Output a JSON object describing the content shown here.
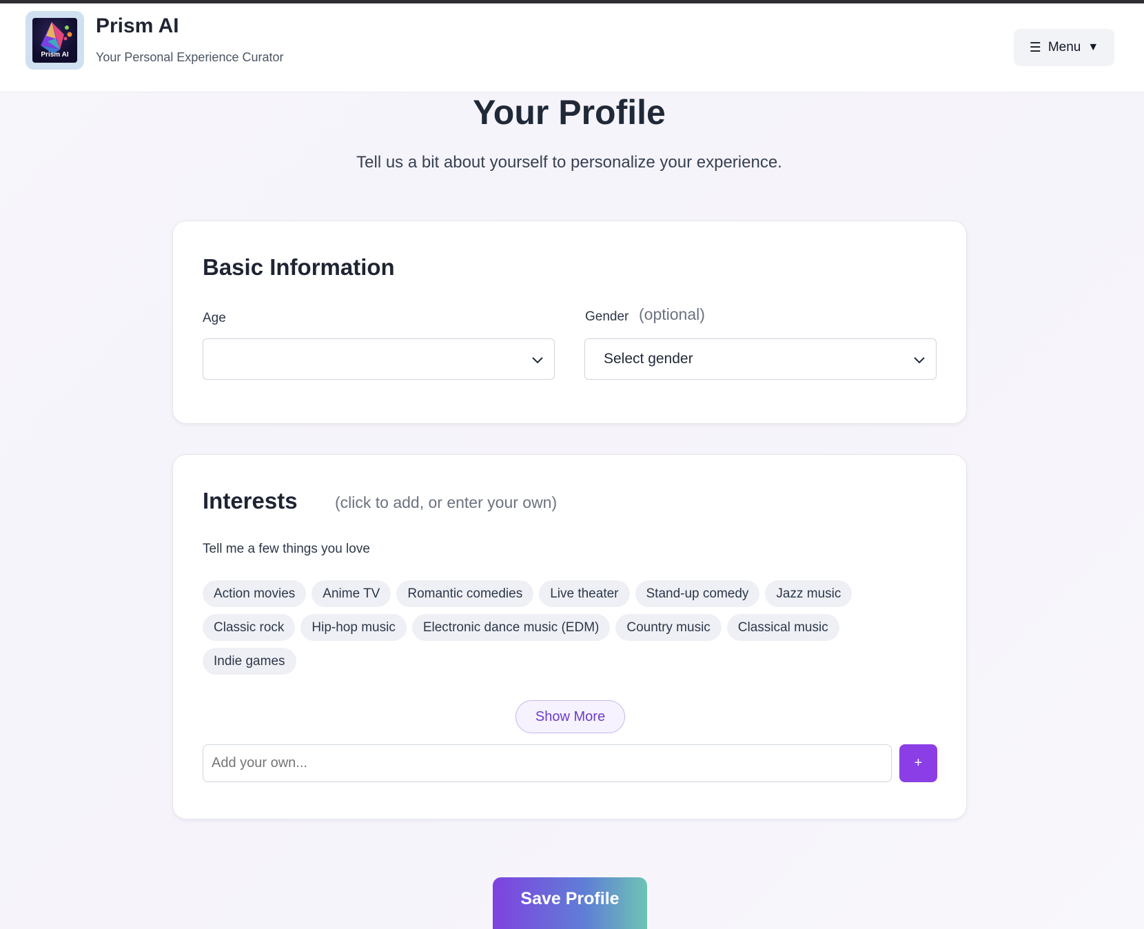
{
  "header": {
    "app_title": "Prism AI",
    "tagline": "Your Personal Experience Curator",
    "logo_text": "Prism AI",
    "menu": {
      "icon": "hamburger-icon",
      "label": "Menu",
      "caret": "▼"
    }
  },
  "page": {
    "title": "Your Profile",
    "subtitle": "Tell us a bit about yourself to personalize your experience."
  },
  "basic_info": {
    "heading": "Basic Information",
    "age": {
      "label": "Age",
      "value": ""
    },
    "gender": {
      "label": "Gender",
      "hint": "(optional)",
      "value": "Select gender"
    }
  },
  "interests": {
    "heading": "Interests",
    "hint": "(click to add, or enter your own)",
    "prompt": "Tell me a few things you love",
    "tags": [
      "Action movies",
      "Anime TV",
      "Romantic comedies",
      "Live theater",
      "Stand-up comedy",
      "Jazz music",
      "Classic rock",
      "Hip-hop music",
      "Electronic dance music (EDM)",
      "Country music",
      "Classical music",
      "Indie games"
    ],
    "show_more_label": "Show More",
    "add_input": {
      "placeholder": "Add your own...",
      "value": ""
    },
    "add_button_label": "+"
  },
  "actions": {
    "save_label": "Save Profile"
  },
  "colors": {
    "accent_purple": "#8b3ee6",
    "save_gradient_start": "#7e42e0",
    "save_gradient_end": "#6ec4b4",
    "tag_background": "#eef0f5"
  }
}
